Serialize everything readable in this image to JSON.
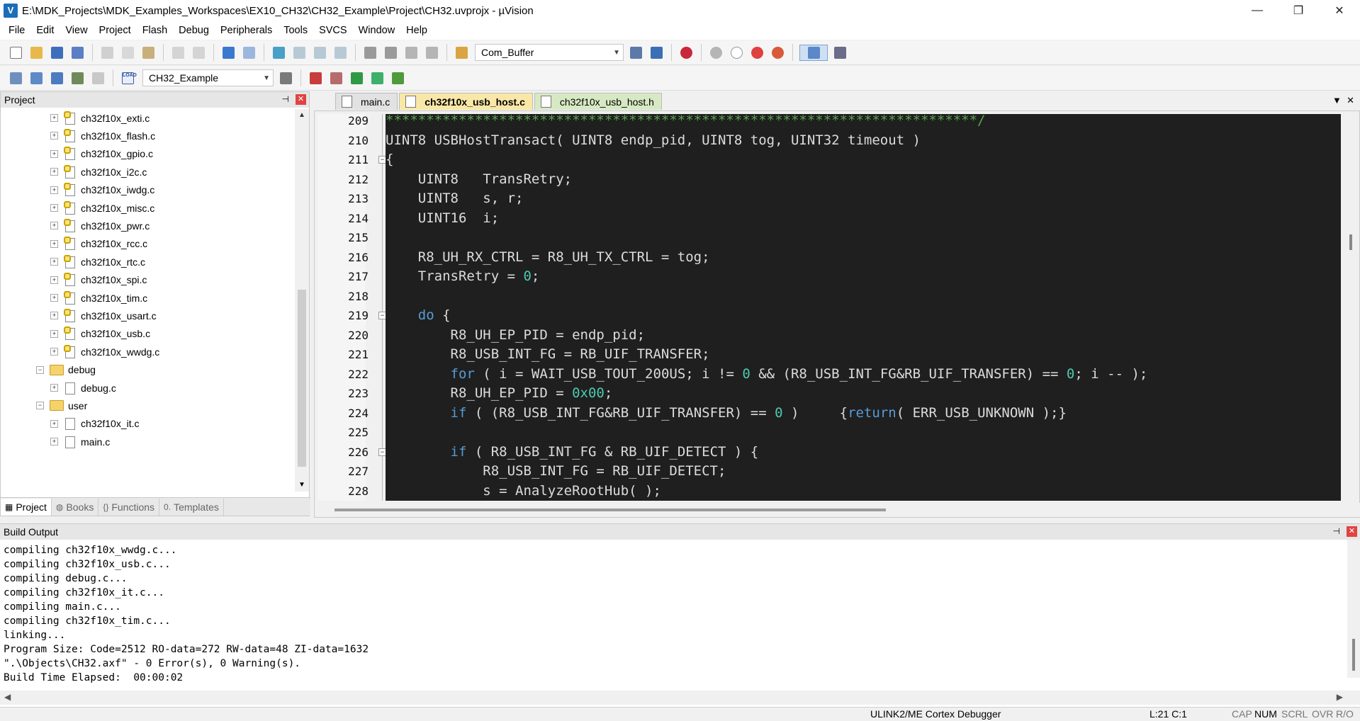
{
  "window": {
    "title": "E:\\MDK_Projects\\MDK_Examples_Workspaces\\EX10_CH32\\CH32_Example\\Project\\CH32.uvprojx - µVision",
    "icon_letter": "V",
    "minimize": "—",
    "maximize": "❐",
    "close": "✕"
  },
  "menu": [
    "File",
    "Edit",
    "View",
    "Project",
    "Flash",
    "Debug",
    "Peripherals",
    "Tools",
    "SVCS",
    "Window",
    "Help"
  ],
  "toolbar": {
    "find_combo": "Com_Buffer",
    "target_combo": "CH32_Example",
    "load_label": "LOAD"
  },
  "project_panel": {
    "title": "Project",
    "pin": "⊣",
    "close": "✕",
    "tree": [
      {
        "label": "ch32f10x_exti.c",
        "kind": "lockfile",
        "level": 2
      },
      {
        "label": "ch32f10x_flash.c",
        "kind": "lockfile",
        "level": 2
      },
      {
        "label": "ch32f10x_gpio.c",
        "kind": "lockfile",
        "level": 2
      },
      {
        "label": "ch32f10x_i2c.c",
        "kind": "lockfile",
        "level": 2
      },
      {
        "label": "ch32f10x_iwdg.c",
        "kind": "lockfile",
        "level": 2
      },
      {
        "label": "ch32f10x_misc.c",
        "kind": "lockfile",
        "level": 2
      },
      {
        "label": "ch32f10x_pwr.c",
        "kind": "lockfile",
        "level": 2
      },
      {
        "label": "ch32f10x_rcc.c",
        "kind": "lockfile",
        "level": 2
      },
      {
        "label": "ch32f10x_rtc.c",
        "kind": "lockfile",
        "level": 2
      },
      {
        "label": "ch32f10x_spi.c",
        "kind": "lockfile",
        "level": 2
      },
      {
        "label": "ch32f10x_tim.c",
        "kind": "lockfile",
        "level": 2
      },
      {
        "label": "ch32f10x_usart.c",
        "kind": "lockfile",
        "level": 2
      },
      {
        "label": "ch32f10x_usb.c",
        "kind": "lockfile",
        "level": 2
      },
      {
        "label": "ch32f10x_wwdg.c",
        "kind": "lockfile",
        "level": 2
      },
      {
        "label": "debug",
        "kind": "folder",
        "level": 1
      },
      {
        "label": "debug.c",
        "kind": "file",
        "level": 2
      },
      {
        "label": "user",
        "kind": "folder",
        "level": 1
      },
      {
        "label": "ch32f10x_it.c",
        "kind": "file",
        "level": 2
      },
      {
        "label": "main.c",
        "kind": "file",
        "level": 2
      }
    ],
    "tabs": [
      {
        "label": "Project",
        "icon": "▦"
      },
      {
        "label": "Books",
        "icon": "◍"
      },
      {
        "label": "Functions",
        "icon": "{}"
      },
      {
        "label": "Templates",
        "icon": "0."
      }
    ]
  },
  "editor": {
    "tabs": [
      "main.c",
      "ch32f10x_usb_host.c",
      "ch32f10x_usb_host.h"
    ],
    "active_tab": 1,
    "lines": [
      {
        "n": "209",
        "segs": [
          {
            "t": "*************************************************************************/",
            "c": "cmt"
          }
        ]
      },
      {
        "n": "210",
        "segs": [
          {
            "t": "UINT8 USBHostTransact( UINT8 endp_pid, UINT8 tog, UINT32 timeout )",
            "c": ""
          }
        ]
      },
      {
        "n": "211",
        "fold": true,
        "segs": [
          {
            "t": "{",
            "c": ""
          }
        ]
      },
      {
        "n": "212",
        "segs": [
          {
            "t": "    UINT8   TransRetry;",
            "c": ""
          }
        ]
      },
      {
        "n": "213",
        "segs": [
          {
            "t": "    UINT8   s, r;",
            "c": ""
          }
        ]
      },
      {
        "n": "214",
        "segs": [
          {
            "t": "    UINT16  i;",
            "c": ""
          }
        ]
      },
      {
        "n": "215",
        "segs": []
      },
      {
        "n": "216",
        "segs": [
          {
            "t": "    R8_UH_RX_CTRL = R8_UH_TX_CTRL = tog;",
            "c": ""
          }
        ]
      },
      {
        "n": "217",
        "segs": [
          {
            "t": "    TransRetry = ",
            "c": ""
          },
          {
            "t": "0",
            "c": "num"
          },
          {
            "t": ";",
            "c": ""
          }
        ]
      },
      {
        "n": "218",
        "segs": []
      },
      {
        "n": "219",
        "fold": true,
        "segs": [
          {
            "t": "    ",
            "c": ""
          },
          {
            "t": "do",
            "c": "kw"
          },
          {
            "t": " {",
            "c": ""
          }
        ]
      },
      {
        "n": "220",
        "segs": [
          {
            "t": "        R8_UH_EP_PID = endp_pid;",
            "c": ""
          }
        ]
      },
      {
        "n": "221",
        "segs": [
          {
            "t": "        R8_USB_INT_FG = RB_UIF_TRANSFER;",
            "c": ""
          }
        ]
      },
      {
        "n": "222",
        "segs": [
          {
            "t": "        ",
            "c": ""
          },
          {
            "t": "for",
            "c": "kw"
          },
          {
            "t": " ( i = WAIT_USB_TOUT_200US; i != ",
            "c": ""
          },
          {
            "t": "0",
            "c": "num"
          },
          {
            "t": " && (R8_USB_INT_FG&RB_UIF_TRANSFER) == ",
            "c": ""
          },
          {
            "t": "0",
            "c": "num"
          },
          {
            "t": "; i -- );",
            "c": ""
          }
        ]
      },
      {
        "n": "223",
        "segs": [
          {
            "t": "        R8_UH_EP_PID = ",
            "c": ""
          },
          {
            "t": "0x00",
            "c": "num"
          },
          {
            "t": ";",
            "c": ""
          }
        ]
      },
      {
        "n": "224",
        "segs": [
          {
            "t": "        ",
            "c": ""
          },
          {
            "t": "if",
            "c": "kw"
          },
          {
            "t": " ( (R8_USB_INT_FG&RB_UIF_TRANSFER) == ",
            "c": ""
          },
          {
            "t": "0",
            "c": "num"
          },
          {
            "t": " )     {",
            "c": ""
          },
          {
            "t": "return",
            "c": "kw"
          },
          {
            "t": "( ERR_USB_UNKNOWN );}",
            "c": ""
          }
        ]
      },
      {
        "n": "225",
        "segs": []
      },
      {
        "n": "226",
        "fold": true,
        "segs": [
          {
            "t": "        ",
            "c": ""
          },
          {
            "t": "if",
            "c": "kw"
          },
          {
            "t": " ( R8_USB_INT_FG & RB_UIF_DETECT ) {",
            "c": ""
          }
        ]
      },
      {
        "n": "227",
        "segs": [
          {
            "t": "            R8_USB_INT_FG = RB_UIF_DETECT;",
            "c": ""
          }
        ]
      },
      {
        "n": "228",
        "segs": [
          {
            "t": "            s = AnalyzeRootHub( );",
            "c": ""
          }
        ]
      }
    ]
  },
  "build_output": {
    "title": "Build Output",
    "lines": [
      "compiling ch32f10x_wwdg.c...",
      "compiling ch32f10x_usb.c...",
      "compiling debug.c...",
      "compiling ch32f10x_it.c...",
      "compiling main.c...",
      "compiling ch32f10x_tim.c...",
      "linking...",
      "Program Size: Code=2512 RO-data=272 RW-data=48 ZI-data=1632",
      "\".\\Objects\\CH32.axf\" - 0 Error(s), 0 Warning(s).",
      "Build Time Elapsed:  00:00:02"
    ]
  },
  "status": {
    "debugger": "ULINK2/ME Cortex Debugger",
    "position": "L:21 C:1",
    "cap": "CAP",
    "num": "NUM",
    "scrl": "SCRL",
    "ovr": "OVR",
    "rw": "R/O"
  },
  "colors": {
    "code_bg": "#1f1f1f",
    "keyword": "#569cd6",
    "number": "#4ec9b0",
    "comment": "#57a64a",
    "active_tab": "#f9e7a8"
  }
}
